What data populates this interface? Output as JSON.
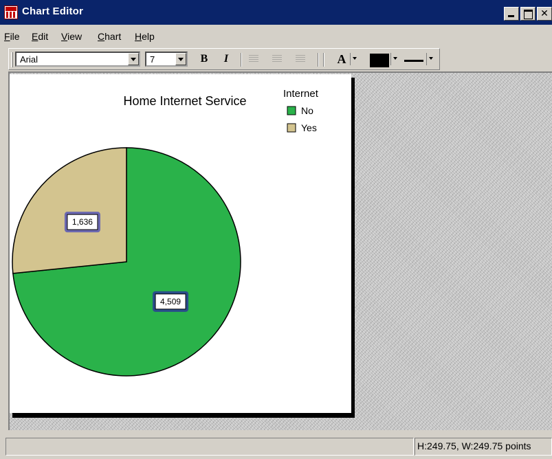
{
  "window": {
    "title": "Chart Editor"
  },
  "menu": [
    {
      "label": "File",
      "u": "F",
      "rest": "ile"
    },
    {
      "label": "Edit",
      "u": "E",
      "rest": "dit"
    },
    {
      "label": "View",
      "u": "V",
      "rest": "iew"
    },
    {
      "label": "Chart",
      "u": "C",
      "rest": "hart"
    },
    {
      "label": "Help",
      "u": "H",
      "rest": "elp"
    }
  ],
  "toolbar": {
    "font_name": "Arial",
    "font_size": "7",
    "bold_label": "B",
    "italic_label": "I",
    "text_color_label": "A",
    "fill_color": "#000000"
  },
  "chart_data": {
    "type": "pie",
    "title": "Home Internet Service",
    "legend_title": "Internet",
    "legend_position": "top-right",
    "slices": [
      {
        "label": "No",
        "value": 4509,
        "value_label": "4,509",
        "color": "#2ab24a"
      },
      {
        "label": "Yes",
        "value": 1636,
        "value_label": "1,636",
        "color": "#d3c48f"
      }
    ]
  },
  "status": {
    "left_text": "",
    "right_text": "H:249.75, W:249.75 points"
  }
}
